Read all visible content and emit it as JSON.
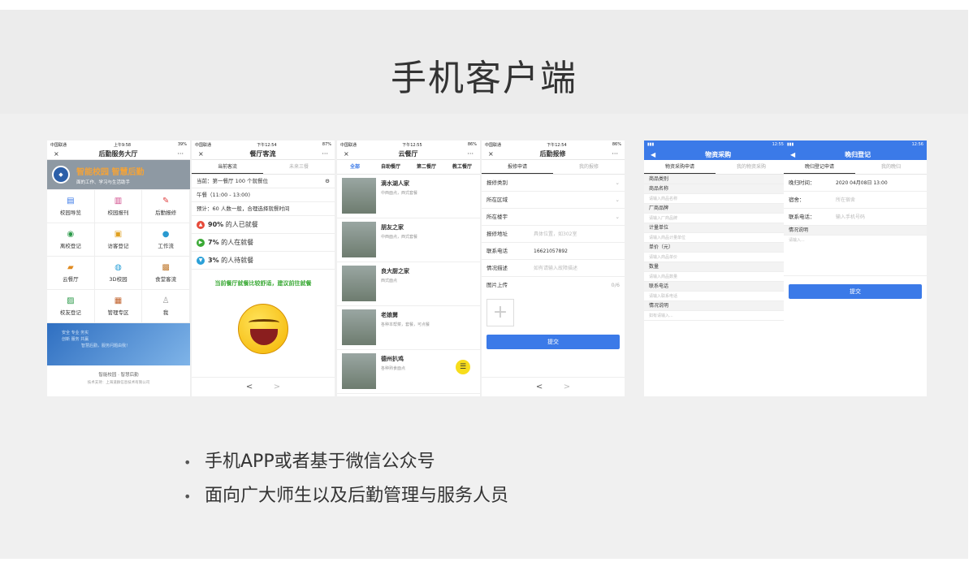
{
  "title": "手机客户端",
  "bullets": [
    "手机APP或者基于微信公众号",
    "面向广大师生以及后勤管理与服务人员"
  ],
  "screen1": {
    "status_left": "中国联通",
    "status_time": "上午9:58",
    "status_right": "39%",
    "nav_close": "×",
    "nav_title": "后勤服务大厅",
    "nav_more": "···",
    "hero_title": "智能校园 智慧后勤",
    "hero_sub": "面的工作、学习与生活助手",
    "items": [
      "校园导览",
      "校园报刊",
      "后勤报修",
      "离校登记",
      "访客登记",
      "工作流",
      "云餐厅",
      "3D校园",
      "食堂客流",
      "校友登记",
      "管理专区",
      "我"
    ],
    "banner_1": "安全 专业 务实",
    "banner_2": "创新 服务 共赢",
    "banner_3": "智慧后勤，服务问题由我！",
    "foot_1": "智能校园 · 智慧后勤",
    "foot_2": "技术支持：上海道群信息技术有限公司"
  },
  "screen2": {
    "status_left": "中国联通",
    "status_time": "下午12:54",
    "status_right": "87%",
    "nav_close": "×",
    "nav_title": "餐厅客流",
    "nav_more": "···",
    "tab_1": "当前客流",
    "tab_2": "未来三餐",
    "current": "当前：第一餐厅 100 个就餐位",
    "lunch": "午餐（11:00 - 13:00)",
    "estimate": "预计：60 人数一般，合理选择就餐时间",
    "pct_1": "90%",
    "pct_1_text": " 的人已就餐",
    "pct_2": "7%",
    "pct_2_text": " 的人在就餐",
    "pct_3": "3%",
    "pct_3_text": " 的人待就餐",
    "advice": "当前餐厅就餐比较舒适，建议前往就餐",
    "prev": "<",
    "next": ">"
  },
  "screen3": {
    "status_left": "中国联通",
    "status_time": "下午12:55",
    "status_right": "86%",
    "nav_close": "×",
    "nav_title": "云餐厅",
    "nav_more": "···",
    "tabs": [
      "全部",
      "自助餐厅",
      "第二餐厅",
      "教工餐厅"
    ],
    "restaurants": [
      {
        "name": "滴水湖人家",
        "desc": "中西面点，西式套餐"
      },
      {
        "name": "朋友之家",
        "desc": "中西面点，西式套餐"
      },
      {
        "name": "良大厨之家",
        "desc": "西式面点"
      },
      {
        "name": "老娘舅",
        "desc": "各种本帮菜，套餐，可点餐"
      },
      {
        "name": "德州扒鸡",
        "desc": "各种熟食面点"
      }
    ]
  },
  "screen4": {
    "status_left": "中国联通",
    "status_time": "下午12:54",
    "status_right": "86%",
    "nav_close": "×",
    "nav_title": "后勤报修",
    "nav_more": "···",
    "tab_1": "报修申请",
    "tab_2": "我的报修",
    "fields": [
      {
        "label": "报修类别",
        "value": ""
      },
      {
        "label": "所在区域",
        "value": ""
      },
      {
        "label": "所在楼宇",
        "value": ""
      },
      {
        "label": "报修地址",
        "value": "具体位置，如302室"
      },
      {
        "label": "联系电话",
        "value": "16621057892"
      },
      {
        "label": "情况描述",
        "value": "如有请输入故障描述"
      }
    ],
    "upload_label": "图片上传",
    "upload_count": "0/6",
    "plus": "+",
    "submit": "提交",
    "prev": "<",
    "next": ">"
  },
  "screen5": {
    "status_time": "12:55",
    "nav_back": "◀",
    "nav_title": "物资采购",
    "tab_1": "物资采购申请",
    "tab_2": "我的物资采购",
    "fields": [
      {
        "label": "商品类别",
        "ph": ""
      },
      {
        "label": "商品名称",
        "ph": "请输入商品名称"
      },
      {
        "label": "厂商品牌",
        "ph": "请输入厂商品牌"
      },
      {
        "label": "计量单位",
        "ph": "请输入商品计量单位"
      },
      {
        "label": "单价（元）",
        "ph": "请输入商品单价"
      },
      {
        "label": "数量",
        "ph": "请输入商品数量"
      },
      {
        "label": "联系电话",
        "ph": "请输入联系电话"
      },
      {
        "label": "情况说明",
        "ph": "如有请输入..."
      }
    ]
  },
  "screen6": {
    "status_time": "12:56",
    "nav_back": "◀",
    "nav_title": "晚归登记",
    "tab_1": "晚归登记申请",
    "tab_2": "我的晚归",
    "time_label": "晚归时间：",
    "time_value": "2020 04月08日 13:00",
    "room_label": "宿舍：",
    "room_ph": "所在宿舍",
    "phone_label": "联系电话：",
    "phone_ph": "输入手机号码",
    "desc_label": "情况说明",
    "desc_ph": "请输入...",
    "submit": "提交"
  },
  "colors": {
    "accent": "#3b7ae8",
    "hero": "#f2a33a",
    "green": "#3aa935"
  }
}
